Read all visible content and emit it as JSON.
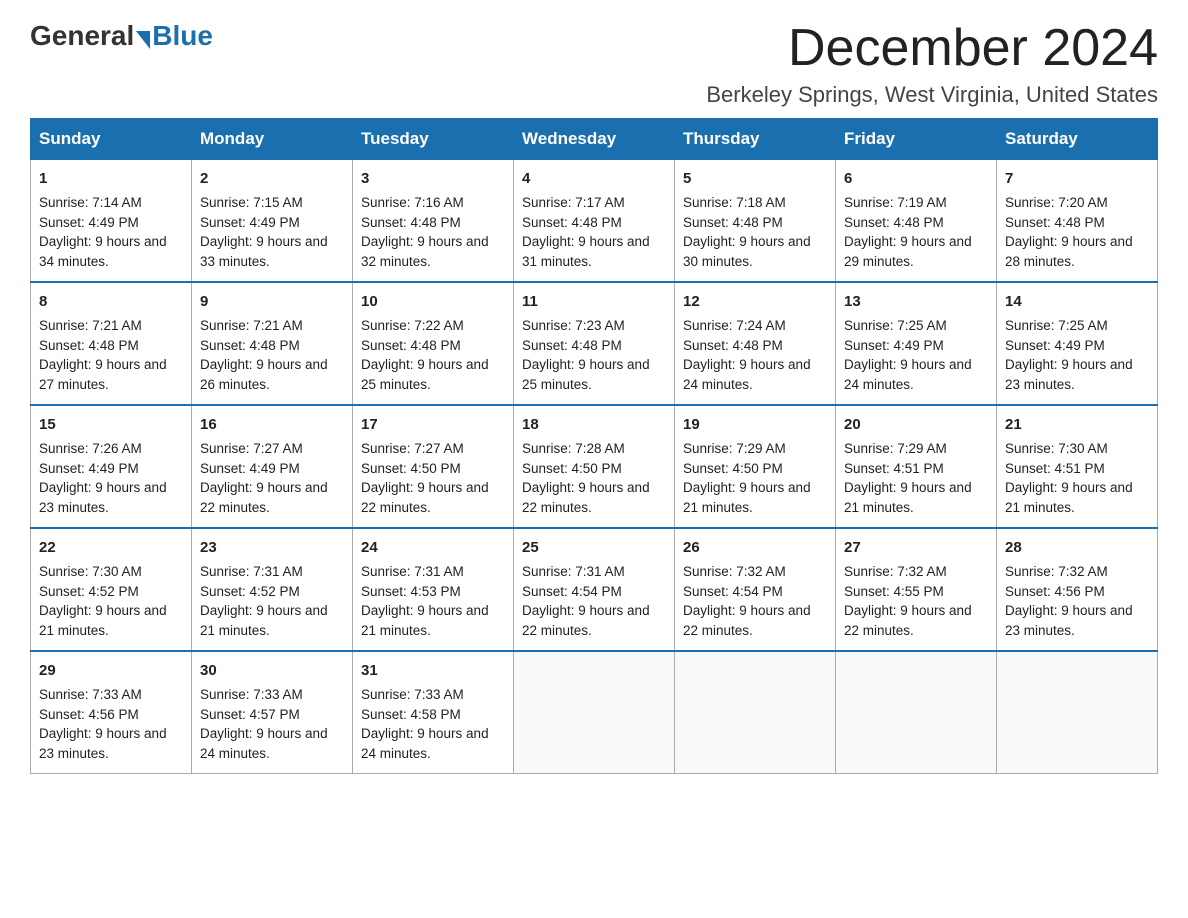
{
  "header": {
    "logo_general": "General",
    "logo_blue": "Blue",
    "month_title": "December 2024",
    "location": "Berkeley Springs, West Virginia, United States"
  },
  "weekdays": [
    "Sunday",
    "Monday",
    "Tuesday",
    "Wednesday",
    "Thursday",
    "Friday",
    "Saturday"
  ],
  "weeks": [
    [
      {
        "day": "1",
        "sunrise": "7:14 AM",
        "sunset": "4:49 PM",
        "daylight": "9 hours and 34 minutes."
      },
      {
        "day": "2",
        "sunrise": "7:15 AM",
        "sunset": "4:49 PM",
        "daylight": "9 hours and 33 minutes."
      },
      {
        "day": "3",
        "sunrise": "7:16 AM",
        "sunset": "4:48 PM",
        "daylight": "9 hours and 32 minutes."
      },
      {
        "day": "4",
        "sunrise": "7:17 AM",
        "sunset": "4:48 PM",
        "daylight": "9 hours and 31 minutes."
      },
      {
        "day": "5",
        "sunrise": "7:18 AM",
        "sunset": "4:48 PM",
        "daylight": "9 hours and 30 minutes."
      },
      {
        "day": "6",
        "sunrise": "7:19 AM",
        "sunset": "4:48 PM",
        "daylight": "9 hours and 29 minutes."
      },
      {
        "day": "7",
        "sunrise": "7:20 AM",
        "sunset": "4:48 PM",
        "daylight": "9 hours and 28 minutes."
      }
    ],
    [
      {
        "day": "8",
        "sunrise": "7:21 AM",
        "sunset": "4:48 PM",
        "daylight": "9 hours and 27 minutes."
      },
      {
        "day": "9",
        "sunrise": "7:21 AM",
        "sunset": "4:48 PM",
        "daylight": "9 hours and 26 minutes."
      },
      {
        "day": "10",
        "sunrise": "7:22 AM",
        "sunset": "4:48 PM",
        "daylight": "9 hours and 25 minutes."
      },
      {
        "day": "11",
        "sunrise": "7:23 AM",
        "sunset": "4:48 PM",
        "daylight": "9 hours and 25 minutes."
      },
      {
        "day": "12",
        "sunrise": "7:24 AM",
        "sunset": "4:48 PM",
        "daylight": "9 hours and 24 minutes."
      },
      {
        "day": "13",
        "sunrise": "7:25 AM",
        "sunset": "4:49 PM",
        "daylight": "9 hours and 24 minutes."
      },
      {
        "day": "14",
        "sunrise": "7:25 AM",
        "sunset": "4:49 PM",
        "daylight": "9 hours and 23 minutes."
      }
    ],
    [
      {
        "day": "15",
        "sunrise": "7:26 AM",
        "sunset": "4:49 PM",
        "daylight": "9 hours and 23 minutes."
      },
      {
        "day": "16",
        "sunrise": "7:27 AM",
        "sunset": "4:49 PM",
        "daylight": "9 hours and 22 minutes."
      },
      {
        "day": "17",
        "sunrise": "7:27 AM",
        "sunset": "4:50 PM",
        "daylight": "9 hours and 22 minutes."
      },
      {
        "day": "18",
        "sunrise": "7:28 AM",
        "sunset": "4:50 PM",
        "daylight": "9 hours and 22 minutes."
      },
      {
        "day": "19",
        "sunrise": "7:29 AM",
        "sunset": "4:50 PM",
        "daylight": "9 hours and 21 minutes."
      },
      {
        "day": "20",
        "sunrise": "7:29 AM",
        "sunset": "4:51 PM",
        "daylight": "9 hours and 21 minutes."
      },
      {
        "day": "21",
        "sunrise": "7:30 AM",
        "sunset": "4:51 PM",
        "daylight": "9 hours and 21 minutes."
      }
    ],
    [
      {
        "day": "22",
        "sunrise": "7:30 AM",
        "sunset": "4:52 PM",
        "daylight": "9 hours and 21 minutes."
      },
      {
        "day": "23",
        "sunrise": "7:31 AM",
        "sunset": "4:52 PM",
        "daylight": "9 hours and 21 minutes."
      },
      {
        "day": "24",
        "sunrise": "7:31 AM",
        "sunset": "4:53 PM",
        "daylight": "9 hours and 21 minutes."
      },
      {
        "day": "25",
        "sunrise": "7:31 AM",
        "sunset": "4:54 PM",
        "daylight": "9 hours and 22 minutes."
      },
      {
        "day": "26",
        "sunrise": "7:32 AM",
        "sunset": "4:54 PM",
        "daylight": "9 hours and 22 minutes."
      },
      {
        "day": "27",
        "sunrise": "7:32 AM",
        "sunset": "4:55 PM",
        "daylight": "9 hours and 22 minutes."
      },
      {
        "day": "28",
        "sunrise": "7:32 AM",
        "sunset": "4:56 PM",
        "daylight": "9 hours and 23 minutes."
      }
    ],
    [
      {
        "day": "29",
        "sunrise": "7:33 AM",
        "sunset": "4:56 PM",
        "daylight": "9 hours and 23 minutes."
      },
      {
        "day": "30",
        "sunrise": "7:33 AM",
        "sunset": "4:57 PM",
        "daylight": "9 hours and 24 minutes."
      },
      {
        "day": "31",
        "sunrise": "7:33 AM",
        "sunset": "4:58 PM",
        "daylight": "9 hours and 24 minutes."
      },
      null,
      null,
      null,
      null
    ]
  ]
}
